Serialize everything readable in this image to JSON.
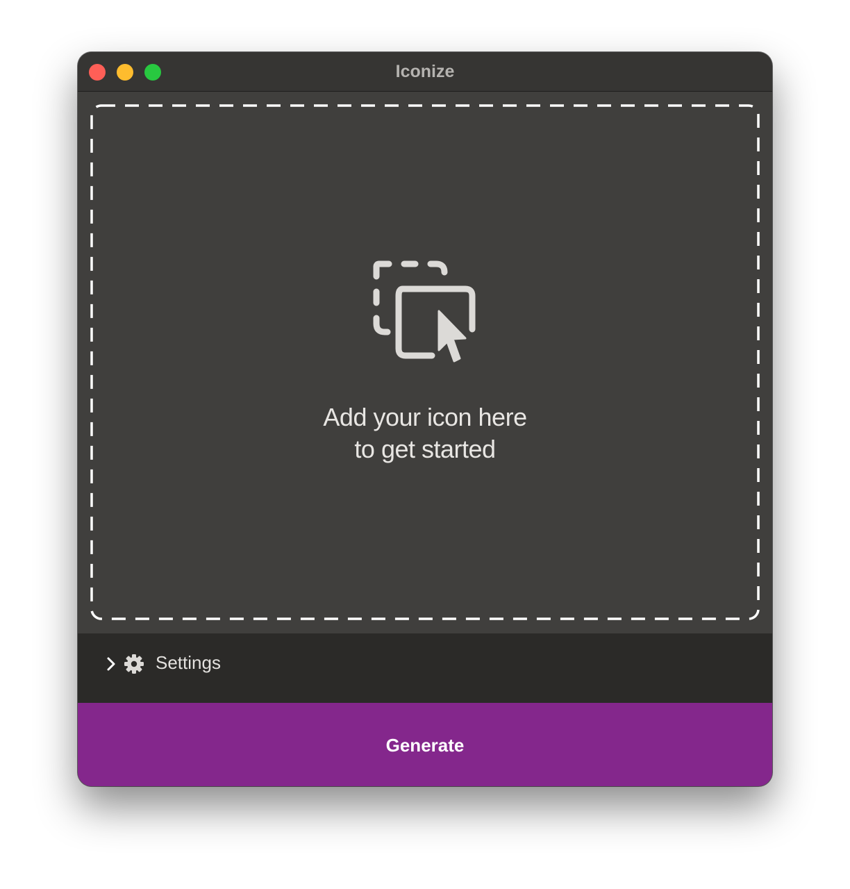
{
  "window": {
    "title": "Iconize"
  },
  "dropzone": {
    "line1": "Add your icon here",
    "line2": "to get started",
    "icon": "drag-drop-icon"
  },
  "settings": {
    "label": "Settings",
    "expanded": false,
    "icons": [
      "chevron-right-icon",
      "gear-icon"
    ]
  },
  "actions": {
    "generate_label": "Generate"
  },
  "colors": {
    "accent": "#84278c",
    "titlebar": "#363533",
    "content_bg": "#403f3d",
    "settings_bg": "#2b2a28",
    "close": "#fe5f57",
    "minimize": "#febc2e",
    "maximize": "#28c840"
  }
}
